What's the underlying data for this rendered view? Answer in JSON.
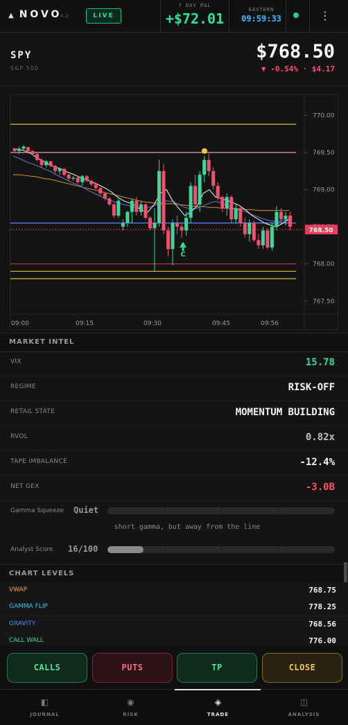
{
  "header": {
    "brand": "NOVO",
    "version": "4.3",
    "live_label": "LIVE",
    "pnl_label": "7 DAY P&L",
    "pnl_value": "+$72.01",
    "clock_label": "EASTERN",
    "clock_value": "09:59:33",
    "menu_icon": "kebab-icon"
  },
  "ticker": {
    "symbol": "SPY",
    "name": "S&P 500",
    "price": "$768.50",
    "change": "▼ -0.54% · $4.17"
  },
  "colors": {
    "green": "#35d99a",
    "red": "#ff4d6a",
    "vwap": "#f5a623",
    "gamma_flip": "#39c6e6",
    "gravity": "#4d8dff",
    "call_wall": "#35d99a",
    "candle_up": "#3ed69a",
    "candle_down": "#f0506e",
    "level_yellow": "#e0b93a",
    "level_pink": "#e8a0b8",
    "level_red": "#c0364b"
  },
  "chart_data": {
    "type": "candlestick",
    "ylim": [
      767.4,
      770.2
    ],
    "y_ticks": [
      "770.00",
      "769.50",
      "769.00",
      "768.50",
      "768.00",
      "767.50"
    ],
    "x_ticks": [
      "09:00",
      "09:15",
      "09:30",
      "09:45",
      "09:56"
    ],
    "last_price_label": "768.50",
    "last_price": 768.5,
    "marker_label": "C",
    "levels": [
      {
        "value": 769.88,
        "color": "#e0b93a"
      },
      {
        "value": 769.5,
        "color": "#e8a0b8"
      },
      {
        "value": 768.55,
        "color": "#4d8dff"
      },
      {
        "value": 768.0,
        "color": "#c0364b"
      },
      {
        "value": 767.9,
        "color": "#e0b93a"
      },
      {
        "value": 767.8,
        "color": "#e0b93a"
      }
    ],
    "candles": [
      [
        769.55,
        769.56,
        769.5,
        769.52
      ],
      [
        769.52,
        769.58,
        769.48,
        769.55
      ],
      [
        769.55,
        769.6,
        769.52,
        769.58
      ],
      [
        769.57,
        769.58,
        769.5,
        769.52
      ],
      [
        769.52,
        769.53,
        769.46,
        769.48
      ],
      [
        769.48,
        769.49,
        769.38,
        769.4
      ],
      [
        769.4,
        769.42,
        769.3,
        769.33
      ],
      [
        769.33,
        769.4,
        769.3,
        769.38
      ],
      [
        769.38,
        769.39,
        769.3,
        769.32
      ],
      [
        769.32,
        769.33,
        769.22,
        769.25
      ],
      [
        769.25,
        769.3,
        769.2,
        769.28
      ],
      [
        769.28,
        769.29,
        769.18,
        769.2
      ],
      [
        769.2,
        769.21,
        769.12,
        769.15
      ],
      [
        769.15,
        769.18,
        769.12,
        769.16
      ],
      [
        769.16,
        769.17,
        769.08,
        769.1
      ],
      [
        769.1,
        769.2,
        769.05,
        769.18
      ],
      [
        769.18,
        769.2,
        769.1,
        769.12
      ],
      [
        769.12,
        769.13,
        769.05,
        769.07
      ],
      [
        769.07,
        769.1,
        769.0,
        769.02
      ],
      [
        769.02,
        769.03,
        768.92,
        768.95
      ],
      [
        768.95,
        768.97,
        768.86,
        768.88
      ],
      [
        768.88,
        768.9,
        768.78,
        768.8
      ],
      [
        768.8,
        768.82,
        768.62,
        768.65
      ],
      [
        768.65,
        768.88,
        768.62,
        768.85
      ],
      [
        768.5,
        768.6,
        768.45,
        768.55
      ],
      [
        768.55,
        768.72,
        768.5,
        768.7
      ],
      [
        768.7,
        768.88,
        768.55,
        768.85
      ],
      [
        768.85,
        768.9,
        768.65,
        768.7
      ],
      [
        768.7,
        768.85,
        768.65,
        768.8
      ],
      [
        768.8,
        768.82,
        768.6,
        768.62
      ],
      [
        768.62,
        768.64,
        768.45,
        768.48
      ],
      [
        768.48,
        768.75,
        767.9,
        768.55
      ],
      [
        768.55,
        769.4,
        768.5,
        769.25
      ],
      [
        769.25,
        769.35,
        768.4,
        768.45
      ],
      [
        768.45,
        768.5,
        768.1,
        768.2
      ],
      [
        768.2,
        768.6,
        767.98,
        768.55
      ],
      [
        768.55,
        768.65,
        768.4,
        768.5
      ],
      [
        768.5,
        768.55,
        768.35,
        768.45
      ],
      [
        768.45,
        768.7,
        768.38,
        768.62
      ],
      [
        768.62,
        769.1,
        768.55,
        769.05
      ],
      [
        769.05,
        769.2,
        768.75,
        768.8
      ],
      [
        768.8,
        769.25,
        768.7,
        769.2
      ],
      [
        769.2,
        769.45,
        769.1,
        769.4
      ],
      [
        769.4,
        769.48,
        769.18,
        769.25
      ],
      [
        769.25,
        769.3,
        769.0,
        769.05
      ],
      [
        769.05,
        769.1,
        768.85,
        768.9
      ],
      [
        768.9,
        768.92,
        768.7,
        768.75
      ],
      [
        768.75,
        768.95,
        768.65,
        768.9
      ],
      [
        768.9,
        768.92,
        768.55,
        768.6
      ],
      [
        768.6,
        768.8,
        768.55,
        768.75
      ],
      [
        768.75,
        768.78,
        768.5,
        768.55
      ],
      [
        768.55,
        768.62,
        768.35,
        768.4
      ],
      [
        768.4,
        768.6,
        768.3,
        768.55
      ],
      [
        768.55,
        768.58,
        768.3,
        768.32
      ],
      [
        768.32,
        768.4,
        768.2,
        768.25
      ],
      [
        768.25,
        768.5,
        768.2,
        768.45
      ],
      [
        768.45,
        768.48,
        768.2,
        768.22
      ],
      [
        768.22,
        768.55,
        768.18,
        768.5
      ],
      [
        768.5,
        768.78,
        768.45,
        768.7
      ],
      [
        768.7,
        768.75,
        768.55,
        768.6
      ],
      [
        768.6,
        768.7,
        768.52,
        768.65
      ],
      [
        768.65,
        768.7,
        768.45,
        768.5
      ]
    ],
    "ma_fast": [
      769.55,
      769.54,
      769.52,
      769.48,
      769.42,
      769.38,
      769.33,
      769.3,
      769.27,
      769.23,
      769.2,
      769.16,
      769.13,
      769.1,
      769.06,
      769.02,
      768.97,
      768.9,
      768.85,
      768.82,
      768.78,
      768.72,
      768.7,
      768.8,
      768.95,
      769.0,
      768.85,
      768.75,
      768.65,
      768.7,
      768.78,
      768.95,
      769.0,
      768.9,
      768.88,
      768.85,
      768.82,
      768.78,
      768.72,
      768.65,
      768.6,
      768.55,
      768.52,
      768.5,
      768.55,
      768.6
    ],
    "ma_mid": [
      769.45,
      769.42,
      769.38,
      769.35,
      769.32,
      769.28,
      769.25,
      769.2,
      769.16,
      769.12,
      769.08,
      769.05,
      769.0,
      768.96,
      768.92,
      768.88,
      768.85,
      768.82,
      768.8,
      768.78,
      768.76,
      768.75,
      768.76,
      768.78,
      768.82,
      768.85,
      768.84,
      768.8,
      768.76,
      768.74,
      768.75,
      768.78,
      768.82,
      768.84,
      768.82,
      768.78,
      768.75,
      768.72,
      768.7,
      768.66,
      768.63,
      768.6,
      768.58,
      768.57,
      768.58,
      768.6
    ],
    "ma_slow": [
      769.2,
      769.2,
      769.19,
      769.18,
      769.17,
      769.15,
      769.14,
      769.12,
      769.1,
      769.08,
      769.06,
      769.04,
      769.02,
      769.0,
      768.98,
      768.96,
      768.94,
      768.92,
      768.9,
      768.88,
      768.86,
      768.84,
      768.83,
      768.82,
      768.81,
      768.81,
      768.81,
      768.8,
      768.79,
      768.78,
      768.77,
      768.77,
      768.76,
      768.76,
      768.75,
      768.75,
      768.74,
      768.74,
      768.73,
      768.73,
      768.72,
      768.72,
      768.72,
      768.72,
      768.72,
      768.72
    ]
  },
  "market_intel": {
    "title": "MARKET INTEL",
    "rows": [
      {
        "label": "VIX",
        "value": "15.78"
      },
      {
        "label": "REGIME",
        "value": "RISK-OFF"
      },
      {
        "label": "RETAIL STATE",
        "value": "MOMENTUM BUILDING"
      },
      {
        "label": "RVOL",
        "value": "0.82x"
      },
      {
        "label": "TAPE IMBALANCE",
        "value": "-12.4%"
      },
      {
        "label": "NET GEX",
        "value": "-3.0B"
      }
    ],
    "gamma_squeeze": {
      "label": "Gamma Squeeze",
      "value": "Quiet",
      "note": "short gamma, but away from the line",
      "level": 0
    },
    "analyst_score": {
      "label": "Analyst Score",
      "value": "16/100",
      "level": 0.16
    }
  },
  "chart_levels": {
    "title": "CHART LEVELS",
    "rows": [
      {
        "label": "VWAP",
        "value": "768.75"
      },
      {
        "label": "GAMMA FLIP",
        "value": "778.25"
      },
      {
        "label": "GRAVITY",
        "value": "768.56"
      },
      {
        "label": "CALL WALL",
        "value": "776.00"
      }
    ]
  },
  "actions": {
    "calls": "CALLS",
    "puts": "PUTS",
    "tp": "TP",
    "close": "CLOSE"
  },
  "nav": {
    "items": [
      {
        "label": "JOURNAL",
        "icon": "journal-icon"
      },
      {
        "label": "RISK",
        "icon": "risk-icon"
      },
      {
        "label": "TRADE",
        "icon": "trade-icon"
      },
      {
        "label": "ANALYSIS",
        "icon": "analysis-icon"
      }
    ],
    "active": "TRADE"
  }
}
